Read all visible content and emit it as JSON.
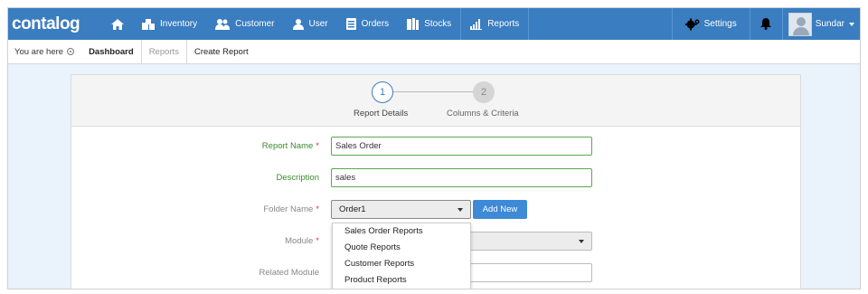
{
  "app": {
    "logo": "contalog"
  },
  "nav": {
    "items": [
      {
        "label": "",
        "icon": "home-icon"
      },
      {
        "label": "Inventory",
        "icon": "inventory-icon"
      },
      {
        "label": "Customer",
        "icon": "customer-icon"
      },
      {
        "label": "User",
        "icon": "user-icon"
      },
      {
        "label": "Orders",
        "icon": "orders-icon"
      },
      {
        "label": "Stocks",
        "icon": "stocks-icon"
      },
      {
        "label": "Reports",
        "icon": "reports-icon"
      }
    ],
    "settings_label": "Settings",
    "user_name": "Sundar"
  },
  "breadcrumb": {
    "prefix": "You are here",
    "items": [
      "Dashboard",
      "Reports",
      "Create Report"
    ]
  },
  "wizard": {
    "steps": [
      {
        "number": "1",
        "label": "Report Details"
      },
      {
        "number": "2",
        "label": "Columns & Criteria"
      }
    ]
  },
  "form": {
    "report_name": {
      "label": "Report Name",
      "value": "Sales Order"
    },
    "description": {
      "label": "Description",
      "value": "sales"
    },
    "folder_name": {
      "label": "Folder Name",
      "value": "Order1",
      "add_new_label": "Add New"
    },
    "module": {
      "label": "Module"
    },
    "related_module": {
      "label": "Related Module"
    }
  },
  "dropdown": {
    "options": [
      "Sales Order Reports",
      "Quote Reports",
      "Customer Reports",
      "Product Reports"
    ]
  },
  "colors": {
    "primary": "#3a7dc0",
    "valid_green": "#3b8a2f",
    "required_red": "#d23a3a"
  }
}
